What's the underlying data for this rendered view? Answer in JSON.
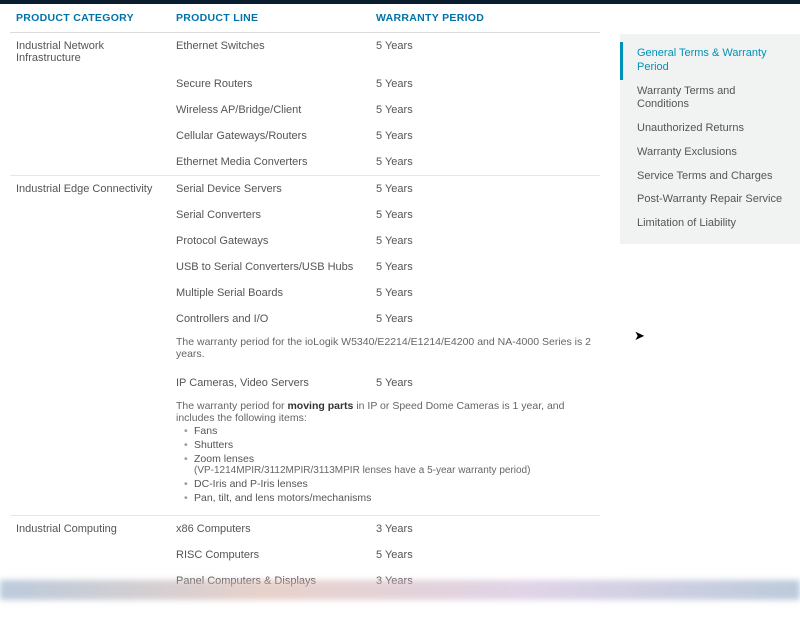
{
  "table": {
    "headers": {
      "category": "PRODUCT CATEGORY",
      "line": "PRODUCT LINE",
      "warranty": "WARRANTY PERIOD"
    },
    "groups": [
      {
        "category": "Industrial Network Infrastructure",
        "rows": [
          {
            "line": "Ethernet Switches",
            "warranty": "5 Years"
          },
          {
            "line": "Secure Routers",
            "warranty": "5 Years"
          },
          {
            "line": "Wireless AP/Bridge/Client",
            "warranty": "5 Years"
          },
          {
            "line": "Cellular Gateways/Routers",
            "warranty": "5 Years"
          },
          {
            "line": "Ethernet Media Converters",
            "warranty": "5 Years"
          }
        ]
      },
      {
        "category": "Industrial Edge Connectivity",
        "rows": [
          {
            "line": "Serial Device Servers",
            "warranty": "5 Years"
          },
          {
            "line": "Serial Converters",
            "warranty": "5 Years"
          },
          {
            "line": "Protocol Gateways",
            "warranty": "5 Years"
          },
          {
            "line": "USB to Serial Converters/USB Hubs",
            "warranty": "5 Years"
          },
          {
            "line": "Multiple Serial Boards",
            "warranty": "5 Years"
          },
          {
            "line": "Controllers and I/O",
            "warranty": "5 Years"
          }
        ],
        "note1": "The warranty period for the ioLogik W5340/E2214/E1214/E4200 and NA-4000 Series is 2 years.",
        "rows2": [
          {
            "line": "IP Cameras, Video Servers",
            "warranty": "5 Years"
          }
        ],
        "note2_intro": "The warranty period for ",
        "note2_bold": "moving parts",
        "note2_rest": " in IP or Speed Dome Cameras is 1 year, and includes the following items:",
        "bullets": [
          {
            "text": "Fans"
          },
          {
            "text": "Shutters"
          },
          {
            "text": "Zoom lenses",
            "sub": "(VP-1214MPIR/3112MPIR/3113MPIR lenses have a 5-year warranty period)"
          },
          {
            "text": "DC-Iris and P-Iris lenses"
          },
          {
            "text": "Pan, tilt, and lens motors/mechanisms"
          }
        ]
      },
      {
        "category": "Industrial Computing",
        "rows": [
          {
            "line": "x86 Computers",
            "warranty": "3 Years"
          },
          {
            "line": "RISC Computers",
            "warranty": "5 Years"
          },
          {
            "line": "Panel Computers & Displays",
            "warranty": "3 Years"
          }
        ]
      }
    ]
  },
  "sidebar": {
    "items": [
      {
        "label": "General Terms & Warranty Period",
        "active": true
      },
      {
        "label": "Warranty Terms and Conditions"
      },
      {
        "label": "Unauthorized Returns"
      },
      {
        "label": "Warranty Exclusions"
      },
      {
        "label": "Service Terms and Charges"
      },
      {
        "label": "Post-Warranty Repair Service"
      },
      {
        "label": "Limitation of Liability"
      }
    ]
  }
}
